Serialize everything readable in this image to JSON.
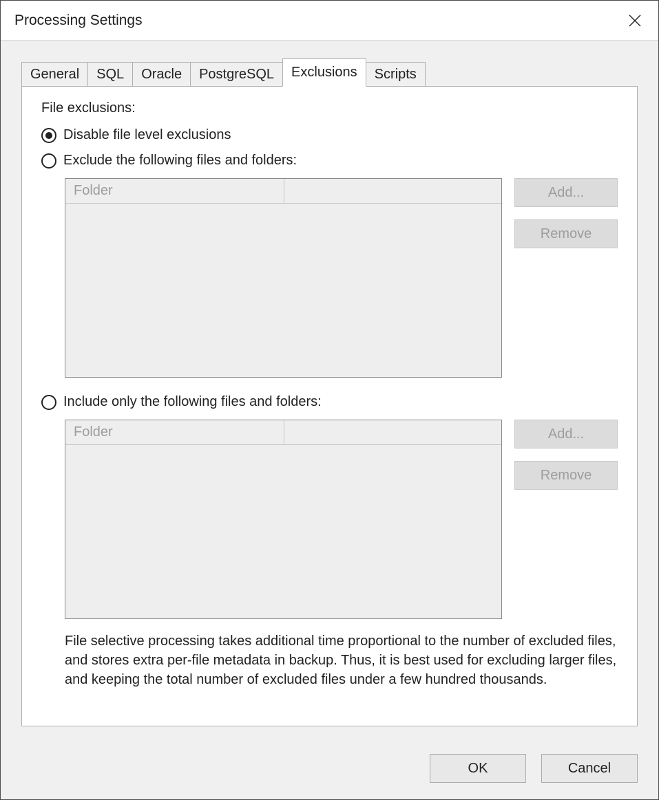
{
  "window_title": "Processing Settings",
  "tabs": [
    "General",
    "SQL",
    "Oracle",
    "PostgreSQL",
    "Exclusions",
    "Scripts"
  ],
  "active_tab_index": 4,
  "section_label": "File exclusions:",
  "radio_disable": "Disable file level exclusions",
  "radio_exclude": "Exclude the following files and folders:",
  "radio_include": "Include only the following files and folders:",
  "selected_radio": "disable",
  "list_column": "Folder",
  "btn_add": "Add...",
  "btn_remove": "Remove",
  "note": "File selective processing takes additional time proportional to the number of excluded files, and stores extra per-file metadata in backup. Thus, it is best used for excluding larger files, and keeping the total number of excluded files under a few hundred thousands.",
  "btn_ok": "OK",
  "btn_cancel": "Cancel"
}
